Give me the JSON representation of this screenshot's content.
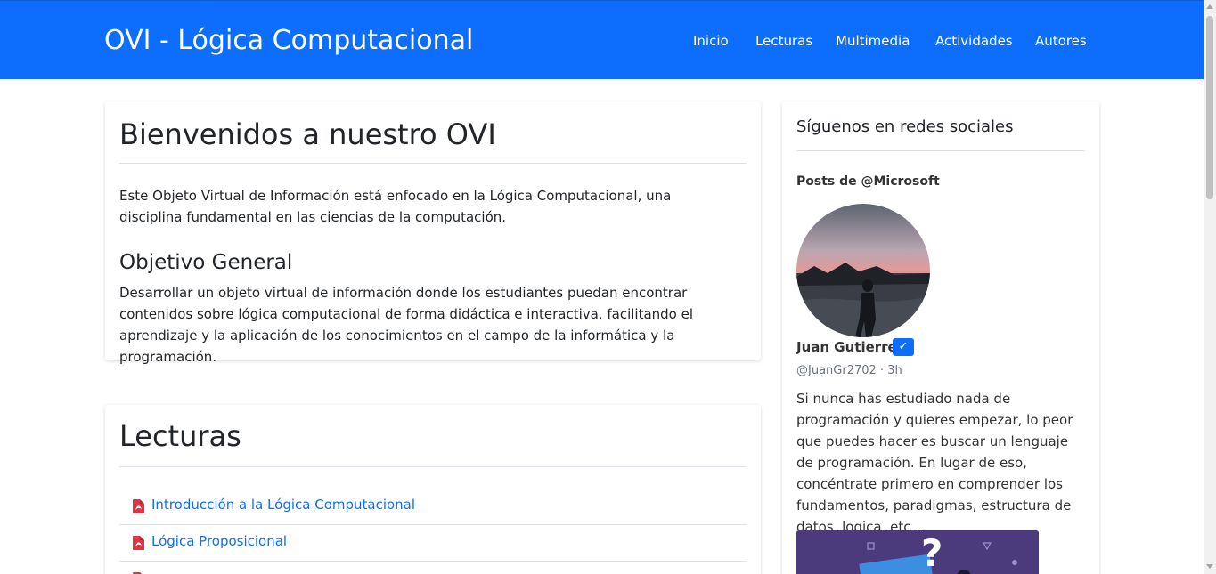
{
  "navbar": {
    "brand": "OVI - Lógica Computacional",
    "links": [
      "Inicio",
      "Lecturas",
      "Multimedia",
      "Actividades",
      "Autores"
    ],
    "background_color": "#0d6efd"
  },
  "welcome": {
    "title": "Bienvenidos a nuestro OVI",
    "intro": "Este Objeto Virtual de Información está enfocado en la Lógica Computacional, una disciplina fundamental en las ciencias de la computación.",
    "objective_title": "Objetivo General",
    "objective_text": "Desarrollar un objeto virtual de información donde los estudiantes puedan encontrar contenidos sobre lógica computacional de forma didáctica e interactiva, facilitando el aprendizaje y la aplicación de los conocimientos en el campo de la informática y la programación."
  },
  "lecturas": {
    "title": "Lecturas",
    "items": [
      {
        "label": "Introducción a la Lógica Computacional",
        "icon": "pdf-icon"
      },
      {
        "label": "Lógica Proposicional",
        "icon": "pdf-icon"
      }
    ]
  },
  "sidebar": {
    "title": "Síguenos en redes sociales",
    "posts_of": "Posts de @Microsoft",
    "post": {
      "author": "Juan Gutierrez",
      "verified_mark": "✓",
      "handle": "@JuanGr2702 · 3h",
      "text": "Si nunca has estudiado nada de programación y quieres empezar, lo peor que puedes hacer es buscar un lenguaje de programación. En lugar de eso, concéntrate primero en comprender los fundamentos, paradigmas, estructura de datos, logica, etc..."
    }
  },
  "colors": {
    "link": "#0d6efd",
    "pdf": "#dc3545"
  }
}
